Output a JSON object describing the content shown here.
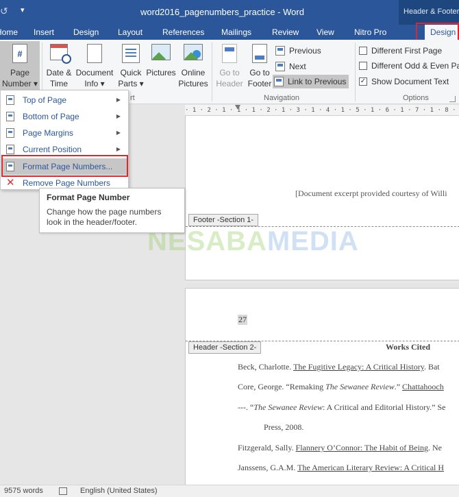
{
  "window": {
    "title": "word2016_pagenumbers_practice - Word",
    "context_tab": "Header & Footer Tools"
  },
  "tabs": [
    "Home",
    "Insert",
    "Design",
    "Layout",
    "References",
    "Mailings",
    "Review",
    "View",
    "Nitro Pro",
    "Design"
  ],
  "ribbon": {
    "page_number": {
      "line1": "Page",
      "line2": "Number"
    },
    "date_time": {
      "line1": "Date &",
      "line2": "Time"
    },
    "document_info": {
      "line1": "Document",
      "line2": "Info"
    },
    "quick_parts": {
      "line1": "Quick",
      "line2": "Parts"
    },
    "pictures": "Pictures",
    "online_pictures": {
      "line1": "Online",
      "line2": "Pictures"
    },
    "insert_group_label": "rt",
    "go_to_header": {
      "line1": "Go to",
      "line2": "Header"
    },
    "go_to_footer": {
      "line1": "Go to",
      "line2": "Footer"
    },
    "previous": "Previous",
    "next": "Next",
    "link_to_previous": "Link to Previous",
    "navigation_group_label": "Navigation",
    "different_first_page": "Different First Page",
    "different_odd_even": "Different Odd & Even Pa",
    "show_document_text": "Show Document Text",
    "options_group_label": "Options",
    "checkbox_states": {
      "different_first_page": false,
      "different_odd_even": false,
      "show_document_text": true
    }
  },
  "dropdown": {
    "items": [
      {
        "label": "Top of Page",
        "submenu": true
      },
      {
        "label": "Bottom of Page",
        "submenu": true
      },
      {
        "label": "Page Margins",
        "submenu": true
      },
      {
        "label": "Current Position",
        "submenu": true
      },
      {
        "label": "Format Page Numbers...",
        "submenu": false
      },
      {
        "label": "Remove Page Numbers",
        "submenu": false
      }
    ]
  },
  "tooltip": {
    "title": "Format Page Number",
    "body_line1": "Change how the page numbers",
    "body_line2": "look in the header/footer."
  },
  "ruler": {
    "text": "· 1 · 2 · 1 · 1 · 1 · 2 · 1 · 3 · 1 · 4 · 1 · 5 · 1 · 6 · 1 · 7 · 1 · 8 · 1 · 9 · 1 · 10 · 1"
  },
  "document": {
    "excerpt": "[Document excerpt provided courtesy of Willi",
    "footer_label": "Footer -Section 1-",
    "page_number": "27",
    "header_label": "Header -Section 2-",
    "works_cited": "Works Cited",
    "refs": [
      {
        "a": "Beck, Charlotte.  ",
        "u": "The Fugitive Legacy: A Critical History",
        "b": ".  Bat"
      },
      {
        "a": "Core, George.  “Remaking ",
        "i": "The Sewanee Review",
        "b": ".”  ",
        "u": "Chattahooch"
      },
      {
        "a": "---. “",
        "i": "The Sewanee Review",
        "b": ": A Critical and Editorial History.”  Se"
      },
      {
        "a": "Press, 2008."
      },
      {
        "a": "Fitzgerald, Sally. ",
        "u": "Flannery O’Connor: The Habit of Being",
        "b": ".  Ne"
      },
      {
        "a": "Janssens, G.A.M. ",
        "u": "The American Literary Review: A Critical H"
      }
    ]
  },
  "watermark": {
    "part1": "NESABA",
    "part2": "MEDIA"
  },
  "status": {
    "words": "9575 words",
    "language": "English (United States)"
  }
}
